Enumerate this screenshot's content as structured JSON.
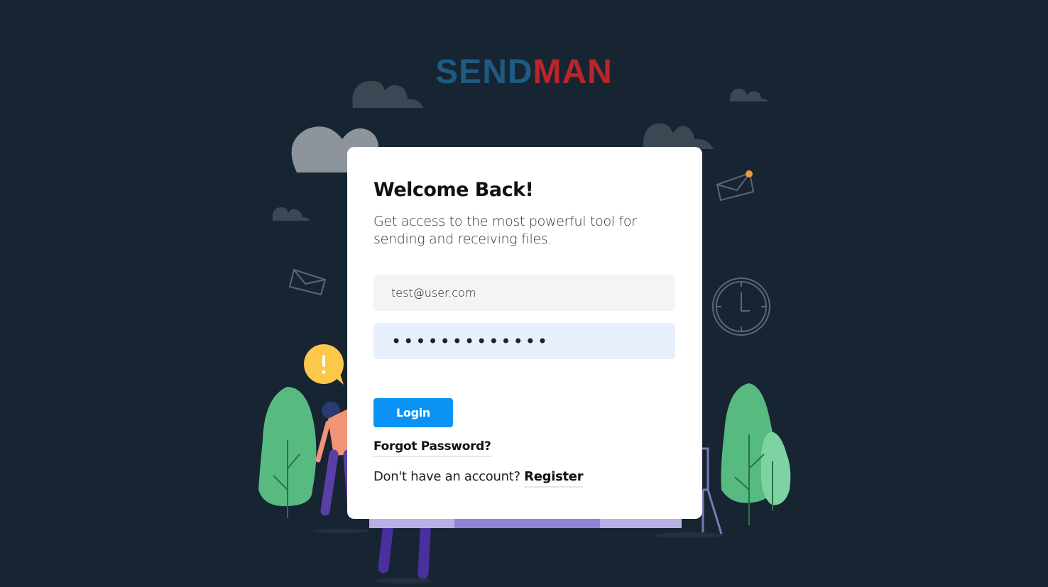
{
  "brand": {
    "logo_part1": "SEND",
    "logo_part2": "MAN"
  },
  "login_card": {
    "title": "Welcome Back!",
    "subtitle": "Get access to the most powerful tool for sending and receiving files.",
    "email_value": "test@user.com",
    "password_value": "•••••••••••••",
    "login_label": "Login",
    "forgot_label": "Forgot Password?",
    "no_account_text": "Don't have an account?",
    "register_label": "Register"
  },
  "colors": {
    "background": "#172533",
    "logo_blue": "#1f5a82",
    "logo_red": "#b8262b",
    "button": "#0a93f5",
    "tree_green": "#57bb81",
    "alert_yellow": "#fcc84a"
  },
  "icons": [
    "cloud-icon",
    "envelope-icon",
    "clock-icon",
    "alert-bubble-icon",
    "tree-icon"
  ]
}
